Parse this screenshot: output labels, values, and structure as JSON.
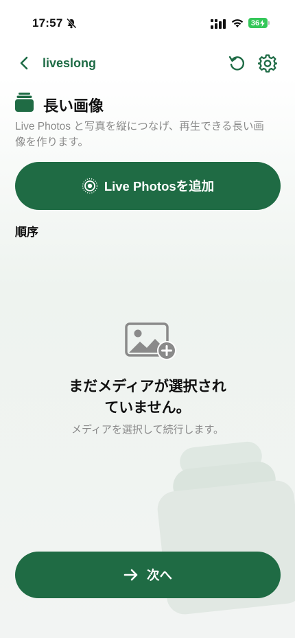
{
  "status_bar": {
    "time": "17:57",
    "battery": "36",
    "silent_icon": "bell-slash-icon",
    "signal_icon": "cellular-signal-icon",
    "wifi_icon": "wifi-icon",
    "battery_color": "#34c759"
  },
  "nav": {
    "back_icon": "chevron-left-icon",
    "title": "liveslong",
    "reset_icon": "rotate-ccw-icon",
    "settings_icon": "gear-icon"
  },
  "header": {
    "icon": "stack-icon",
    "title": "長い画像",
    "description": "Live Photos と写真を縦につなげ、再生できる長い画像を作ります。"
  },
  "add_button": {
    "icon": "live-photo-icon",
    "label": "Live Photosを追加"
  },
  "order": {
    "label": "順序"
  },
  "empty_state": {
    "icon": "photo-add-icon",
    "title": "まだメディアが選択されていません。",
    "subtitle": "メディアを選択して続行します。"
  },
  "next_button": {
    "icon": "arrow-right-icon",
    "label": "次へ"
  },
  "colors": {
    "accent": "#1f6b44",
    "title_green": "#1e6b45",
    "secondary_text": "#8a8a8a"
  }
}
